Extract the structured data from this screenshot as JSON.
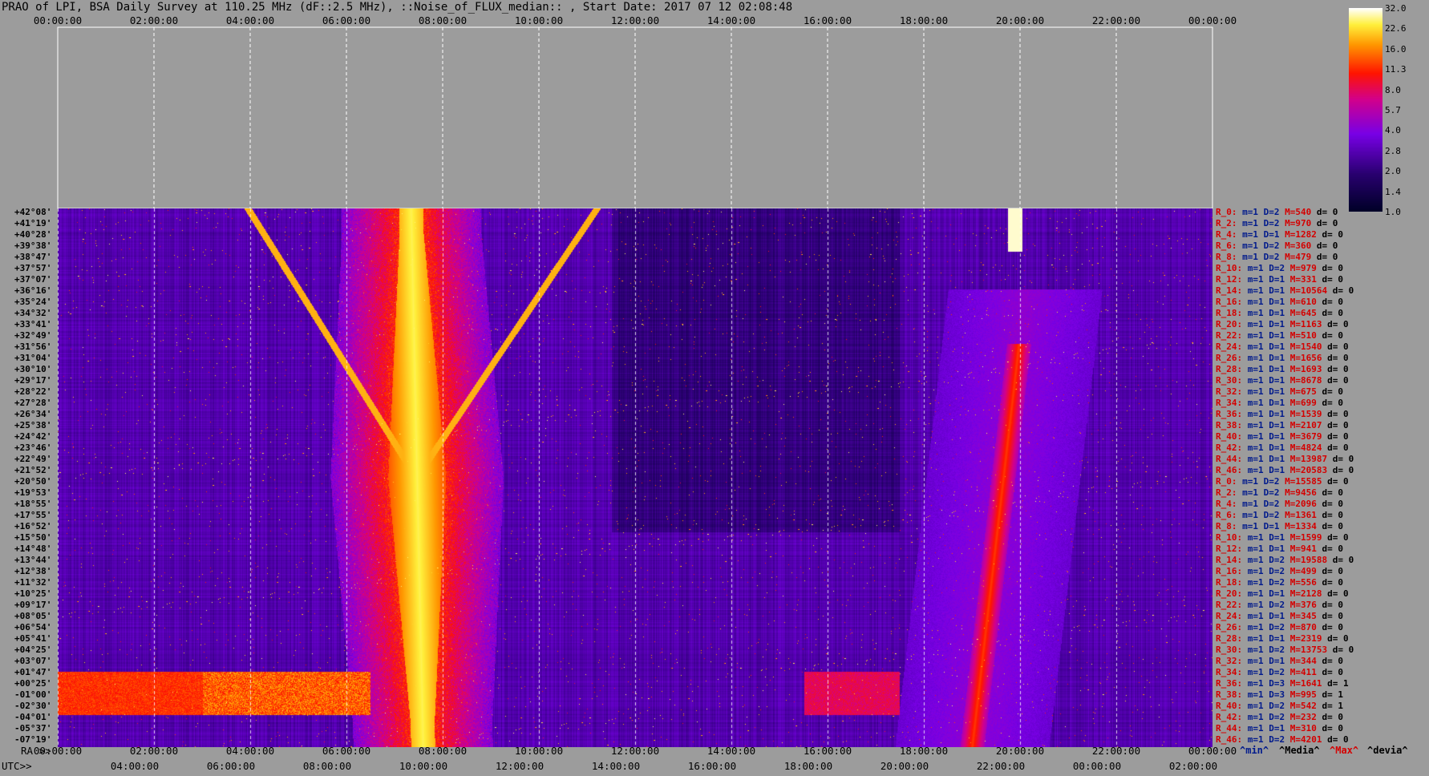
{
  "title": "PRAO of LPI, BSA Daily Survey at 110.25 MHz (dF::2.5 MHz), ::Noise_of_FLUX_median:: , Start Date: 2017 07 12 02:08:48",
  "top_axis_ticks": [
    "00:00:00",
    "02:00:00",
    "04:00:00",
    "06:00:00",
    "08:00:00",
    "10:00:00",
    "12:00:00",
    "14:00:00",
    "16:00:00",
    "18:00:00",
    "20:00:00",
    "22:00:00",
    "00:00:00"
  ],
  "ra_label": "RA >>",
  "ra_ticks": [
    "00:00:00",
    "02:00:00",
    "04:00:00",
    "06:00:00",
    "08:00:00",
    "10:00:00",
    "12:00:00",
    "14:00:00",
    "16:00:00",
    "18:00:00",
    "20:00:00",
    "22:00:00",
    "00:00:00"
  ],
  "utc_label": "UTC>>",
  "utc_ticks": [
    "04:00:00",
    "06:00:00",
    "08:00:00",
    "10:00:00",
    "12:00:00",
    "14:00:00",
    "16:00:00",
    "18:00:00",
    "20:00:00",
    "22:00:00",
    "00:00:00",
    "02:00:00"
  ],
  "declinations": [
    "+42°08'",
    "+41°19'",
    "+40°28'",
    "+39°38'",
    "+38°47'",
    "+37°57'",
    "+37°07'",
    "+36°16'",
    "+35°24'",
    "+34°32'",
    "+33°41'",
    "+32°49'",
    "+31°56'",
    "+31°04'",
    "+30°10'",
    "+29°17'",
    "+28°22'",
    "+27°28'",
    "+26°34'",
    "+25°38'",
    "+24°42'",
    "+23°46'",
    "+22°49'",
    "+21°52'",
    "+20°50'",
    "+19°53'",
    "+18°55'",
    "+17°55'",
    "+16°52'",
    "+15°50'",
    "+14°48'",
    "+13°44'",
    "+12°38'",
    "+11°32'",
    "+10°25'",
    "+09°17'",
    "+08°05'",
    "+06°54'",
    "+05°41'",
    "+04°25'",
    "+03°07'",
    "+01°47'",
    "+00°25'",
    "-01°00'",
    "-02°30'",
    "-04°01'",
    "-05°37'",
    "-07°19'"
  ],
  "row_stats": [
    {
      "r": "R_0:",
      "m": "m=1",
      "d": "D=2",
      "M": "M=540",
      "v": "d= 0"
    },
    {
      "r": "R_2:",
      "m": "m=1",
      "d": "D=2",
      "M": "M=970",
      "v": "d= 0"
    },
    {
      "r": "R_4:",
      "m": "m=1",
      "d": "D=1",
      "M": "M=1282",
      "v": "d= 0"
    },
    {
      "r": "R_6:",
      "m": "m=1",
      "d": "D=2",
      "M": "M=360",
      "v": "d= 0"
    },
    {
      "r": "R_8:",
      "m": "m=1",
      "d": "D=2",
      "M": "M=479",
      "v": "d= 0"
    },
    {
      "r": "R_10:",
      "m": "m=1",
      "d": "D=2",
      "M": "M=979",
      "v": "d= 0"
    },
    {
      "r": "R_12:",
      "m": "m=1",
      "d": "D=1",
      "M": "M=331",
      "v": "d= 0"
    },
    {
      "r": "R_14:",
      "m": "m=1",
      "d": "D=1",
      "M": "M=10564",
      "v": "d= 0"
    },
    {
      "r": "R_16:",
      "m": "m=1",
      "d": "D=1",
      "M": "M=610",
      "v": "d= 0"
    },
    {
      "r": "R_18:",
      "m": "m=1",
      "d": "D=1",
      "M": "M=645",
      "v": "d= 0"
    },
    {
      "r": "R_20:",
      "m": "m=1",
      "d": "D=1",
      "M": "M=1163",
      "v": "d= 0"
    },
    {
      "r": "R_22:",
      "m": "m=1",
      "d": "D=1",
      "M": "M=510",
      "v": "d= 0"
    },
    {
      "r": "R_24:",
      "m": "m=1",
      "d": "D=1",
      "M": "M=1540",
      "v": "d= 0"
    },
    {
      "r": "R_26:",
      "m": "m=1",
      "d": "D=1",
      "M": "M=1656",
      "v": "d= 0"
    },
    {
      "r": "R_28:",
      "m": "m=1",
      "d": "D=1",
      "M": "M=1693",
      "v": "d= 0"
    },
    {
      "r": "R_30:",
      "m": "m=1",
      "d": "D=1",
      "M": "M=8678",
      "v": "d= 0"
    },
    {
      "r": "R_32:",
      "m": "m=1",
      "d": "D=1",
      "M": "M=675",
      "v": "d= 0"
    },
    {
      "r": "R_34:",
      "m": "m=1",
      "d": "D=1",
      "M": "M=699",
      "v": "d= 0"
    },
    {
      "r": "R_36:",
      "m": "m=1",
      "d": "D=1",
      "M": "M=1539",
      "v": "d= 0"
    },
    {
      "r": "R_38:",
      "m": "m=1",
      "d": "D=1",
      "M": "M=2107",
      "v": "d= 0"
    },
    {
      "r": "R_40:",
      "m": "m=1",
      "d": "D=1",
      "M": "M=3679",
      "v": "d= 0"
    },
    {
      "r": "R_42:",
      "m": "m=1",
      "d": "D=1",
      "M": "M=4824",
      "v": "d= 0"
    },
    {
      "r": "R_44:",
      "m": "m=1",
      "d": "D=1",
      "M": "M=13987",
      "v": "d= 0"
    },
    {
      "r": "R_46:",
      "m": "m=1",
      "d": "D=1",
      "M": "M=20583",
      "v": "d= 0"
    },
    {
      "r": "R_0:",
      "m": "m=1",
      "d": "D=2",
      "M": "M=15585",
      "v": "d= 0"
    },
    {
      "r": "R_2:",
      "m": "m=1",
      "d": "D=2",
      "M": "M=9456",
      "v": "d= 0"
    },
    {
      "r": "R_4:",
      "m": "m=1",
      "d": "D=2",
      "M": "M=2096",
      "v": "d= 0"
    },
    {
      "r": "R_6:",
      "m": "m=1",
      "d": "D=2",
      "M": "M=1361",
      "v": "d= 0"
    },
    {
      "r": "R_8:",
      "m": "m=1",
      "d": "D=1",
      "M": "M=1334",
      "v": "d= 0"
    },
    {
      "r": "R_10:",
      "m": "m=1",
      "d": "D=1",
      "M": "M=1599",
      "v": "d= 0"
    },
    {
      "r": "R_12:",
      "m": "m=1",
      "d": "D=1",
      "M": "M=941",
      "v": "d= 0"
    },
    {
      "r": "R_14:",
      "m": "m=1",
      "d": "D=2",
      "M": "M=19588",
      "v": "d= 0"
    },
    {
      "r": "R_16:",
      "m": "m=1",
      "d": "D=2",
      "M": "M=499",
      "v": "d= 0"
    },
    {
      "r": "R_18:",
      "m": "m=1",
      "d": "D=2",
      "M": "M=556",
      "v": "d= 0"
    },
    {
      "r": "R_20:",
      "m": "m=1",
      "d": "D=1",
      "M": "M=2128",
      "v": "d= 0"
    },
    {
      "r": "R_22:",
      "m": "m=1",
      "d": "D=2",
      "M": "M=376",
      "v": "d= 0"
    },
    {
      "r": "R_24:",
      "m": "m=1",
      "d": "D=1",
      "M": "M=345",
      "v": "d= 0"
    },
    {
      "r": "R_26:",
      "m": "m=1",
      "d": "D=2",
      "M": "M=870",
      "v": "d= 0"
    },
    {
      "r": "R_28:",
      "m": "m=1",
      "d": "D=1",
      "M": "M=2319",
      "v": "d= 0"
    },
    {
      "r": "R_30:",
      "m": "m=1",
      "d": "D=2",
      "M": "M=13753",
      "v": "d= 0"
    },
    {
      "r": "R_32:",
      "m": "m=1",
      "d": "D=1",
      "M": "M=344",
      "v": "d= 0"
    },
    {
      "r": "R_34:",
      "m": "m=1",
      "d": "D=2",
      "M": "M=411",
      "v": "d= 0"
    },
    {
      "r": "R_36:",
      "m": "m=1",
      "d": "D=3",
      "M": "M=1641",
      "v": "d= 1"
    },
    {
      "r": "R_38:",
      "m": "m=1",
      "d": "D=3",
      "M": "M=995",
      "v": "d= 1"
    },
    {
      "r": "R_40:",
      "m": "m=1",
      "d": "D=2",
      "M": "M=542",
      "v": "d= 1"
    },
    {
      "r": "R_42:",
      "m": "m=1",
      "d": "D=2",
      "M": "M=232",
      "v": "d= 0"
    },
    {
      "r": "R_44:",
      "m": "m=1",
      "d": "D=1",
      "M": "M=310",
      "v": "d= 0"
    },
    {
      "r": "R_46:",
      "m": "m=1",
      "d": "D=2",
      "M": "M=4201",
      "v": "d= 0"
    }
  ],
  "legend": {
    "min": "^min^",
    "median": "^Media^",
    "max": "^Max^",
    "devia": "^devia^"
  },
  "colorbar_ticks": [
    "32.0",
    "22.6",
    "16.0",
    "11.3",
    "8.0",
    "5.7",
    "4.0",
    "2.8",
    "2.0",
    "1.4",
    "1.0"
  ],
  "colors": {
    "background": "#9c9c9c",
    "low": "#000033",
    "mid": "#7a00ff",
    "high": "#ff1a00",
    "peak": "#ffffff",
    "stat_red": "#d40000",
    "stat_blue": "#001a8c"
  },
  "chart_data": {
    "type": "heatmap",
    "x_axis": "RA (hours)",
    "xlim": [
      0,
      24
    ],
    "y_rows": 48,
    "value_range": [
      1.0,
      32.0
    ],
    "color_scale": "log2",
    "features": [
      {
        "desc": "galactic plane transit",
        "ra_hours": [
          7.2,
          7.6
        ]
      },
      {
        "desc": "bright source",
        "ra_hours": [
          19.8,
          20.0
        ]
      },
      {
        "desc": "broad band along lower rows",
        "ra_hours": [
          0,
          6.5
        ]
      }
    ]
  }
}
